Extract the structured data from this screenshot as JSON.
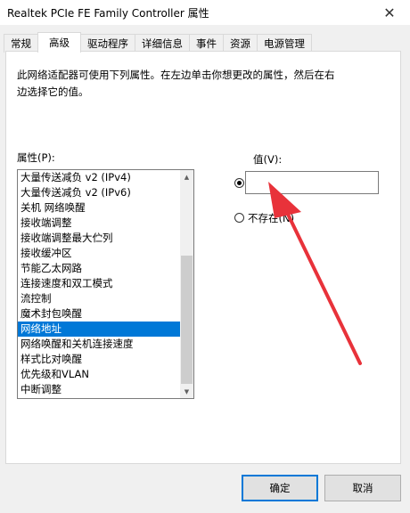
{
  "window": {
    "title": "Realtek PCIe FE Family Controller 属性",
    "close_glyph": "✕"
  },
  "tabs": [
    {
      "label": "常规"
    },
    {
      "label": "高级"
    },
    {
      "label": "驱动程序"
    },
    {
      "label": "详细信息"
    },
    {
      "label": "事件"
    },
    {
      "label": "资源"
    },
    {
      "label": "电源管理"
    }
  ],
  "active_tab": "高级",
  "description_lines": [
    "此网络适配器可使用下列属性。在左边单击你想更改的属性，然后在右",
    "边选择它的值。"
  ],
  "properties": {
    "label": "属性(P):",
    "items": [
      {
        "label": "大量传送减负 v2 (IPv4)"
      },
      {
        "label": "大量传送减负 v2 (IPv6)"
      },
      {
        "label": "关机 网络唤醒"
      },
      {
        "label": "接收端调整"
      },
      {
        "label": "接收端调整最大伫列"
      },
      {
        "label": "接收缓冲区"
      },
      {
        "label": "节能乙太网路"
      },
      {
        "label": "连接速度和双工模式"
      },
      {
        "label": "流控制"
      },
      {
        "label": "魔术封包唤醒"
      },
      {
        "label": "网络地址"
      },
      {
        "label": "网络唤醒和关机连接速度"
      },
      {
        "label": "样式比对唤醒"
      },
      {
        "label": "优先级和VLAN"
      },
      {
        "label": "中断调整"
      }
    ],
    "selected_item": "网络地址"
  },
  "value_section": {
    "label": "值(V):",
    "value_input": "",
    "value_radio_checked": true,
    "not_exist_label": "不存在(N)",
    "not_exist_radio_checked": false
  },
  "buttons": {
    "ok": "确定",
    "cancel": "取消"
  },
  "colors": {
    "selection": "#0078d7",
    "annotation_arrow": "#e8323a"
  },
  "icons": {
    "close": "close-icon",
    "scroll_up": "scroll-up-arrow-icon",
    "scroll_down": "scroll-down-arrow-icon"
  }
}
